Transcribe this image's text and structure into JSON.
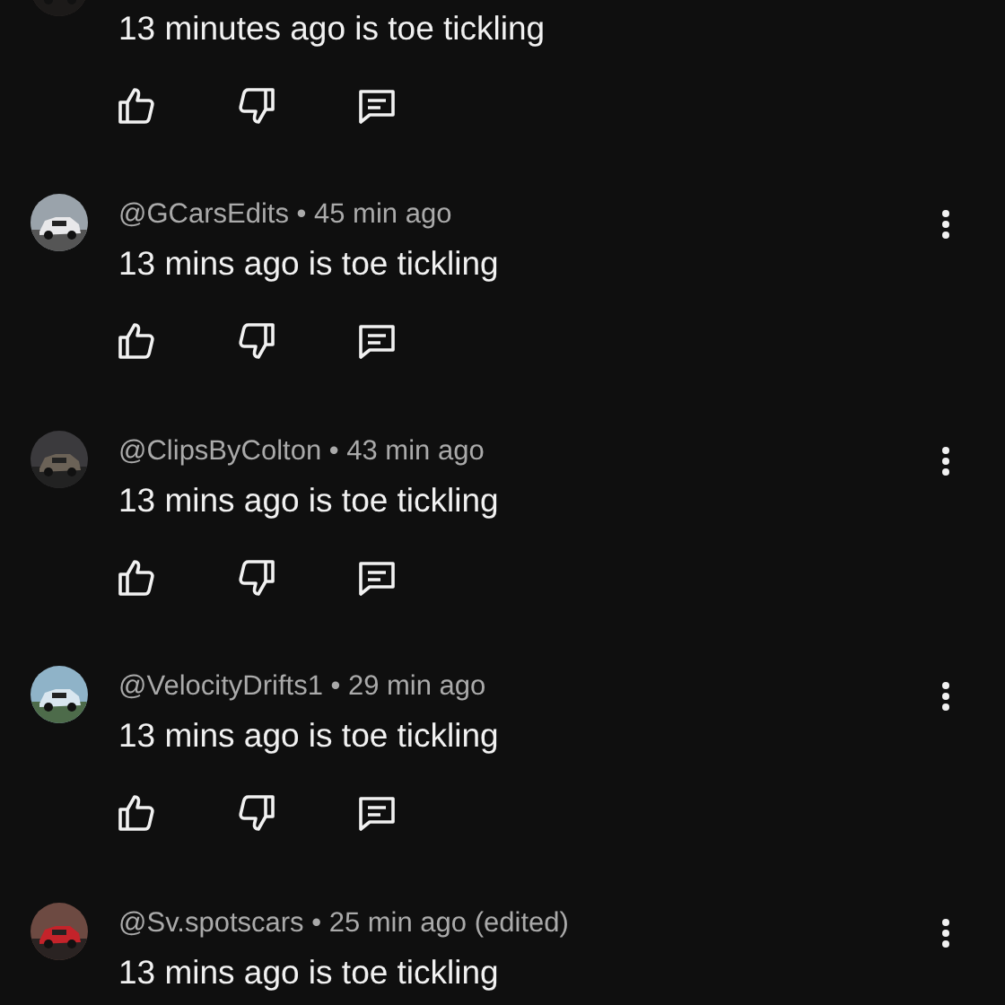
{
  "comments": [
    {
      "body": "13 minutes ago is toe tickling"
    },
    {
      "header": "@GCarsEdits • 45 min ago",
      "body": "13 mins ago is toe tickling"
    },
    {
      "header": "@ClipsByColton • 43 min ago",
      "body": "13 mins ago is toe tickling"
    },
    {
      "header": "@VelocityDrifts1 • 29 min ago",
      "body": "13 mins ago is toe tickling"
    },
    {
      "header": "@Sv.spotscars • 25 min ago (edited)",
      "body": "13 mins ago is toe tickling",
      "actions_shown": false
    }
  ]
}
